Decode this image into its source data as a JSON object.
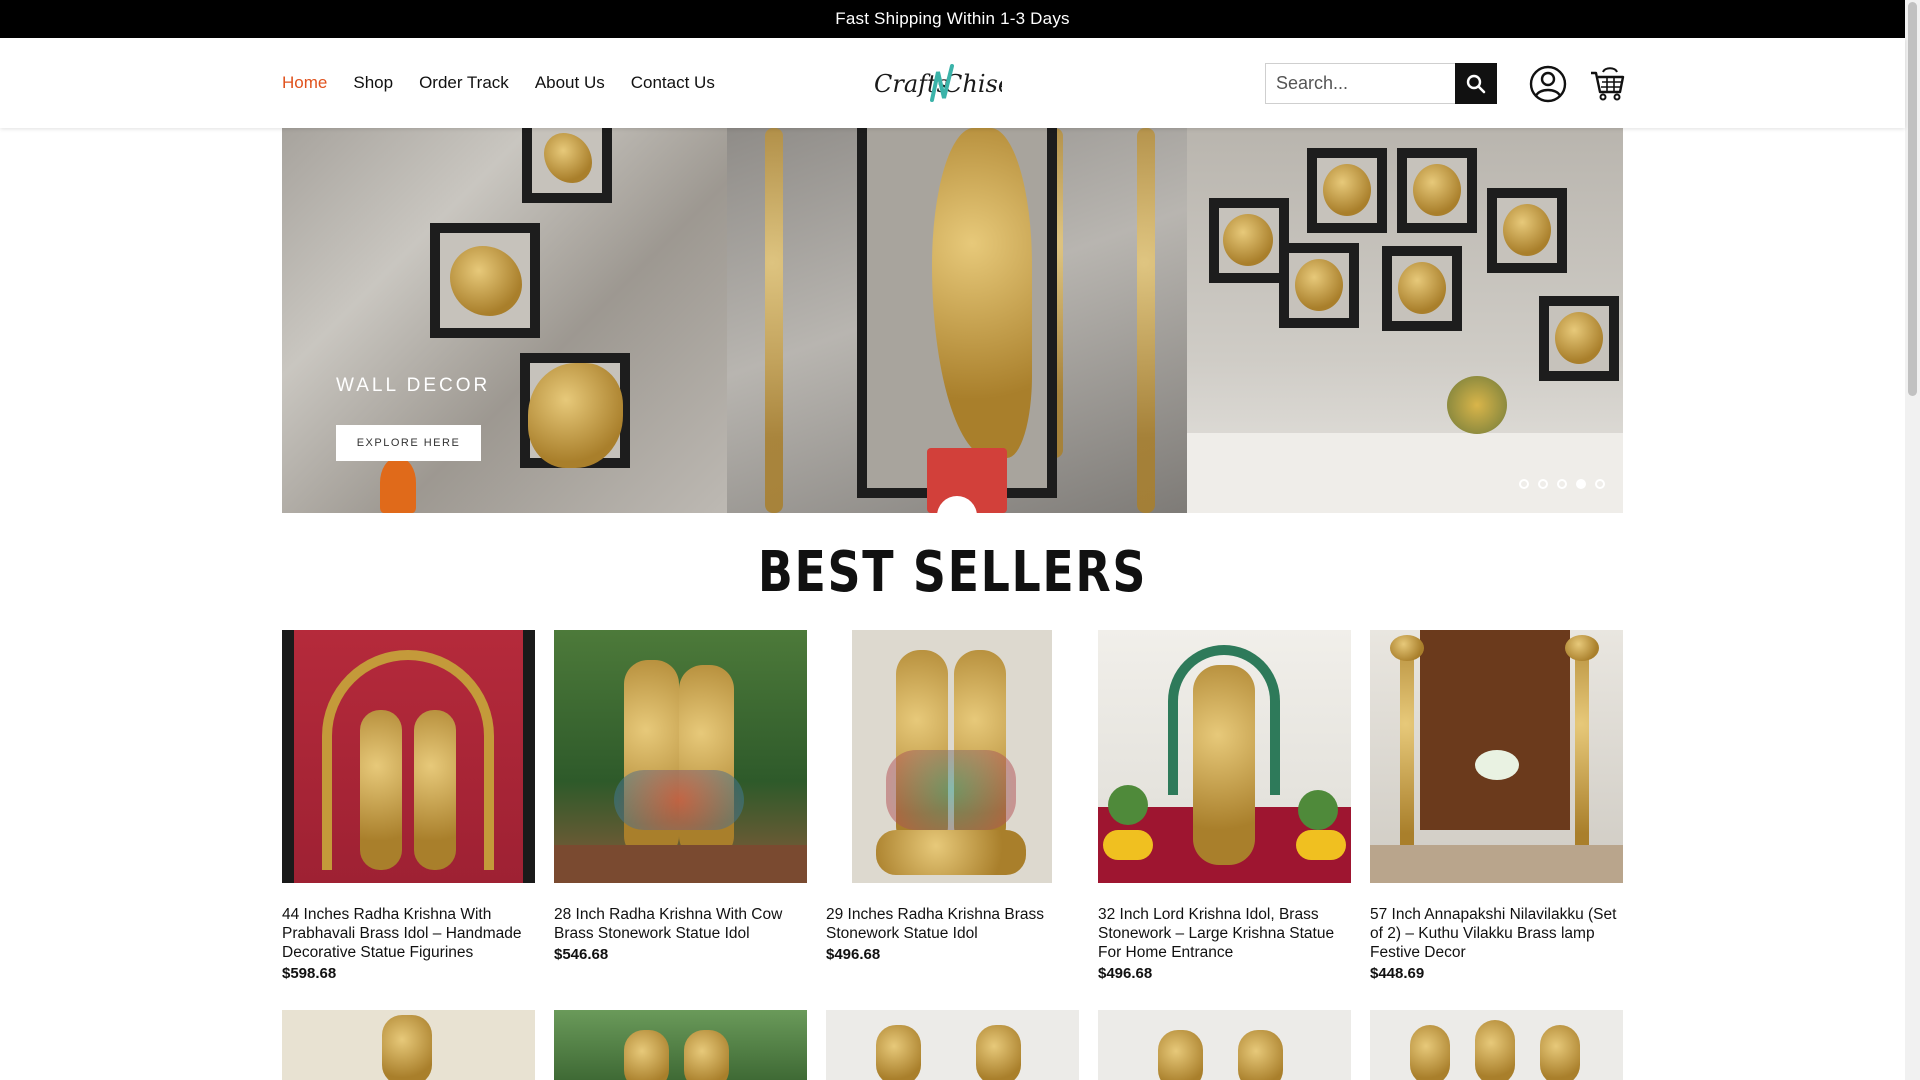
{
  "announcement": "Fast Shipping Within 1-3 Days",
  "nav": {
    "items": [
      {
        "label": "Home",
        "active": true
      },
      {
        "label": "Shop"
      },
      {
        "label": "Order Track"
      },
      {
        "label": "About Us"
      },
      {
        "label": "Contact Us"
      }
    ]
  },
  "logo": {
    "text": "CraftsNChisel"
  },
  "search": {
    "placeholder": "Search...",
    "icon": "search-icon"
  },
  "icons": {
    "account": "user-circle-icon",
    "cart": "shopping-cart-icon"
  },
  "colors": {
    "accent": "#e0521d",
    "topbar": "#000000"
  },
  "hero": {
    "title": "WALL DECOR",
    "button": "EXPLORE HERE",
    "slides": 5,
    "active_slide": 4
  },
  "best_sellers": {
    "title": "BEST SELLERS",
    "products": [
      {
        "name": "44 Inches Radha Krishna With Prabhavali Brass Idol – Handmade Decorative Statue Figurines",
        "price": "$598.68"
      },
      {
        "name": "28 Inch Radha Krishna With Cow Brass Stonework Statue Idol",
        "price": "$546.68"
      },
      {
        "name": "29 Inches Radha Krishna Brass Stonework Statue Idol",
        "price": "$496.68"
      },
      {
        "name": "32 Inch Lord Krishna Idol, Brass Stonework – Large Krishna Statue For Home Entrance",
        "price": "$496.68"
      },
      {
        "name": "57 Inch Annapakshi Nilavilakku (Set of 2) – Kuthu Vilakku Brass lamp Festive Decor",
        "price": "$448.69"
      }
    ]
  }
}
